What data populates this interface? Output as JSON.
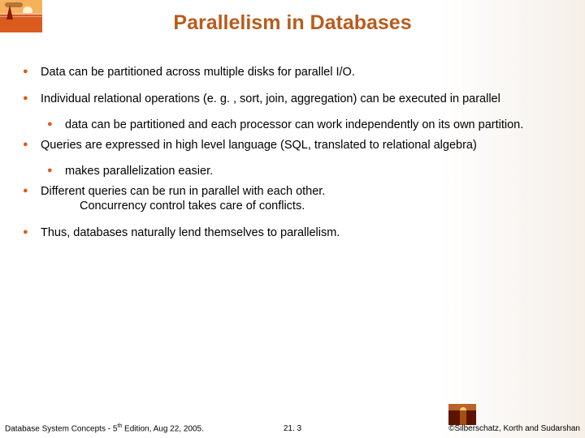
{
  "title": "Parallelism in Databases",
  "bullets": {
    "b1": "Data can be partitioned across multiple disks for parallel I/O.",
    "b2": "Individual relational operations (e. g. , sort, join, aggregation) can be executed in parallel",
    "b2s1": "data can be partitioned and each processor can work independently on its own partition.",
    "b3": "Queries are expressed in high level language (SQL, translated to relational algebra)",
    "b3s1": "makes parallelization easier.",
    "b4a": "Different queries can be run in parallel with each other.",
    "b4b": "Concurrency control takes care of conflicts.",
    "b5": "Thus, databases naturally lend themselves to parallelism."
  },
  "footer": {
    "left_pre": "Database System Concepts - 5",
    "left_sup": "th",
    "left_post": " Edition, Aug 22, 2005.",
    "center": "21. 3",
    "right": "©Silberschatz, Korth and Sudarshan"
  }
}
